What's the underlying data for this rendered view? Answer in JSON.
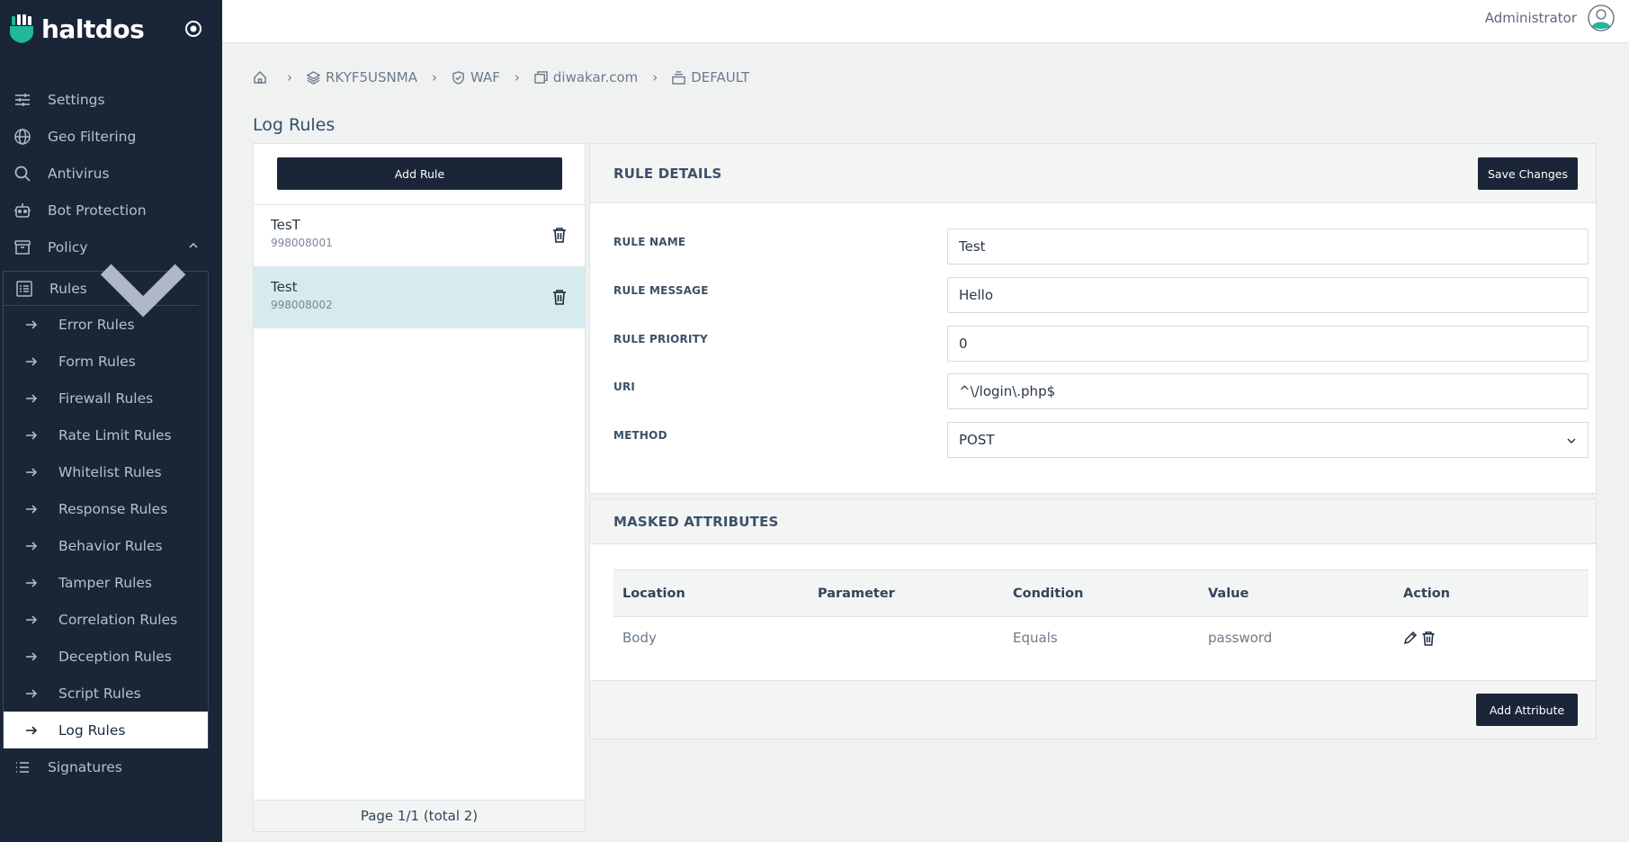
{
  "app": {
    "brand": "haltdos",
    "accent_color": "#1fb89a",
    "sidebar_color": "#1a2538"
  },
  "topbar": {
    "user_name": "Administrator"
  },
  "sidebar": {
    "items": [
      {
        "label": "Settings",
        "icon": "sliders-icon"
      },
      {
        "label": "Geo Filtering",
        "icon": "globe-icon"
      },
      {
        "label": "Antivirus",
        "icon": "search-icon"
      },
      {
        "label": "Bot Protection",
        "icon": "robot-icon"
      },
      {
        "label": "Policy",
        "icon": "archive-icon"
      }
    ],
    "rules_label": "Rules",
    "rule_types": [
      "Error Rules",
      "Form Rules",
      "Firewall Rules",
      "Rate Limit Rules",
      "Whitelist Rules",
      "Response Rules",
      "Behavior Rules",
      "Tamper Rules",
      "Correlation Rules",
      "Deception Rules",
      "Script Rules",
      "Log Rules"
    ],
    "active_rule_type": "Log Rules",
    "signatures_label": "Signatures"
  },
  "breadcrumb": {
    "items": [
      "RKYF5USNMA",
      "WAF",
      "diwakar.com",
      "DEFAULT"
    ]
  },
  "page": {
    "title": "Log Rules"
  },
  "rule_list": {
    "add_label": "Add Rule",
    "rules": [
      {
        "name": "TesT",
        "id": "998008001"
      },
      {
        "name": "Test",
        "id": "998008002"
      }
    ],
    "pagination": "Page 1/1 (total 2)"
  },
  "rule_details": {
    "title": "RULE DETAILS",
    "save_label": "Save Changes",
    "fields": {
      "name_label": "RULE NAME",
      "name_value": "Test",
      "message_label": "RULE MESSAGE",
      "message_value": "Hello",
      "priority_label": "RULE PRIORITY",
      "priority_value": "0",
      "uri_label": "URI",
      "uri_value": "^\\/login\\.php$",
      "method_label": "METHOD",
      "method_value": "POST"
    }
  },
  "masked_attributes": {
    "title": "MASKED ATTRIBUTES",
    "columns": [
      "Location",
      "Parameter",
      "Condition",
      "Value",
      "Action"
    ],
    "rows": [
      {
        "location": "Body",
        "parameter": "",
        "condition": "Equals",
        "value": "password"
      }
    ],
    "add_label": "Add Attribute"
  }
}
